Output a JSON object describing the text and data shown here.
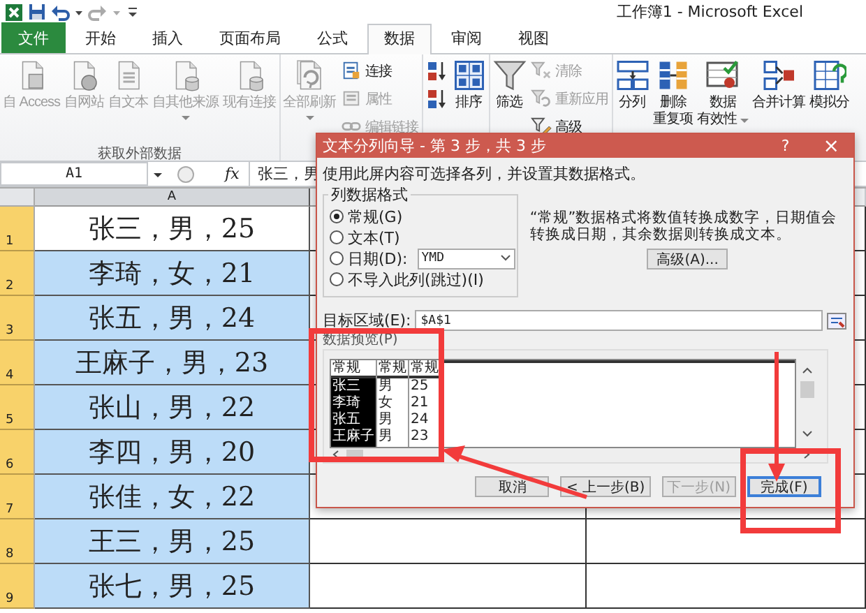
{
  "window": {
    "title": "工作簿1 - Microsoft Excel"
  },
  "ribbon_tabs": [
    {
      "label": "文件",
      "kind": "file",
      "selected": false
    },
    {
      "label": "开始",
      "kind": "tab",
      "selected": false
    },
    {
      "label": "插入",
      "kind": "tab",
      "selected": false
    },
    {
      "label": "页面布局",
      "kind": "tab",
      "selected": false
    },
    {
      "label": "公式",
      "kind": "tab",
      "selected": false
    },
    {
      "label": "数据",
      "kind": "tab",
      "selected": true
    },
    {
      "label": "审阅",
      "kind": "tab",
      "selected": false
    },
    {
      "label": "视图",
      "kind": "tab",
      "selected": false
    }
  ],
  "ribbon": {
    "groups": [
      {
        "label": "获取外部数据",
        "items": [
          {
            "kind": "large",
            "lines": [
              "自 Access"
            ],
            "disabled": true
          },
          {
            "kind": "large",
            "lines": [
              "自网站"
            ],
            "disabled": true
          },
          {
            "kind": "large",
            "lines": [
              "自文本"
            ],
            "disabled": true
          },
          {
            "kind": "large",
            "lines": [
              "自其他来源"
            ],
            "disabled": true,
            "dropdown": true
          },
          {
            "kind": "large",
            "lines": [
              "现有连接"
            ],
            "disabled": true
          }
        ]
      },
      {
        "items": [
          {
            "kind": "large",
            "lines": [
              "全部刷新"
            ],
            "disabled": true,
            "dropdown": true
          },
          {
            "kind": "stack",
            "items": [
              {
                "label": "连接",
                "disabled": false
              },
              {
                "label": "属性",
                "disabled": true
              },
              {
                "label": "编辑链接",
                "disabled": true
              }
            ]
          }
        ]
      },
      {
        "items": [
          {
            "kind": "stack",
            "items": [
              {
                "disabled": false
              },
              {
                "disabled": false
              }
            ]
          },
          {
            "kind": "large",
            "lines": [
              "排序"
            ],
            "disabled": false
          }
        ]
      },
      {
        "items": [
          {
            "kind": "large",
            "lines": [
              "筛选"
            ],
            "disabled": false
          },
          {
            "kind": "stack",
            "items": [
              {
                "label": "清除",
                "disabled": true
              },
              {
                "label": "重新应用",
                "disabled": true
              },
              {
                "label": "高级",
                "disabled": false
              }
            ]
          }
        ]
      },
      {
        "items": [
          {
            "kind": "large",
            "lines": [
              "分列"
            ],
            "disabled": false
          },
          {
            "kind": "large",
            "lines": [
              "删除",
              "重复项"
            ],
            "disabled": false
          },
          {
            "kind": "large",
            "lines": [
              "数据",
              "有效性"
            ],
            "disabled": false,
            "dropdown": true
          },
          {
            "kind": "large",
            "lines": [
              "合并计算"
            ],
            "disabled": false
          },
          {
            "kind": "large",
            "lines": [
              "模拟分"
            ],
            "disabled": false
          }
        ]
      }
    ]
  },
  "formula_bar": {
    "name_box": "A1",
    "function_label": "fx",
    "formula": "张三，男"
  },
  "sheet": {
    "columns": [
      {
        "label": "A"
      }
    ],
    "rows": [
      {
        "number": "1",
        "cells": [
          "张三，男，25"
        ],
        "selected": false
      },
      {
        "number": "2",
        "cells": [
          "李琦，女，21"
        ],
        "selected": true
      },
      {
        "number": "3",
        "cells": [
          "张五，男，24"
        ],
        "selected": true
      },
      {
        "number": "4",
        "cells": [
          "王麻子，男，23"
        ],
        "selected": true
      },
      {
        "number": "5",
        "cells": [
          "张山，男，22"
        ],
        "selected": true
      },
      {
        "number": "6",
        "cells": [
          "李四，男，20"
        ],
        "selected": true
      },
      {
        "number": "7",
        "cells": [
          "张佳，女，22"
        ],
        "selected": true
      },
      {
        "number": "8",
        "cells": [
          "王三，男，25"
        ],
        "selected": true
      },
      {
        "number": "9",
        "cells": [
          "张七，男，25"
        ],
        "selected": true
      }
    ]
  },
  "dialog": {
    "title": "文本分列向导 - 第 3 步，共 3 步",
    "help": "?",
    "close": "×",
    "intro": "使用此屏内容可选择各列，并设置其数据格式。",
    "format_group": {
      "label": "列数据格式",
      "options": [
        {
          "label": "常规(G)",
          "selected": true
        },
        {
          "label": "文本(T)",
          "selected": false
        },
        {
          "label": "日期(D):",
          "selected": false,
          "kind": "date"
        },
        {
          "label": "不导入此列(跳过)(I)",
          "selected": false
        }
      ],
      "date_select": "YMD"
    },
    "description": "“常规”数据格式将数值转换成数字，日期值会转换成日期，其余数据则转换成文本。",
    "advanced_button": "高级(A)...",
    "destination": {
      "label": "目标区域(E):",
      "value": "$A$1"
    },
    "preview": {
      "label": "数据预览(P)",
      "columns": [
        {
          "header": "常规",
          "selected": true
        },
        {
          "header": "常规",
          "selected": false
        },
        {
          "header": "常规",
          "selected": false
        }
      ],
      "rows": [
        [
          "张三",
          "男",
          "25"
        ],
        [
          "李琦",
          "女",
          "21"
        ],
        [
          "张五",
          "男",
          "24"
        ],
        [
          "王麻子",
          "男",
          "23"
        ]
      ]
    },
    "buttons": [
      {
        "label": "取消",
        "disabled": false,
        "default": false
      },
      {
        "label": "< 上一步(B)",
        "disabled": false,
        "default": false
      },
      {
        "label": "下一步(N)",
        "disabled": true,
        "default": false
      },
      {
        "label": "完成(F)",
        "disabled": false,
        "default": true
      }
    ]
  }
}
